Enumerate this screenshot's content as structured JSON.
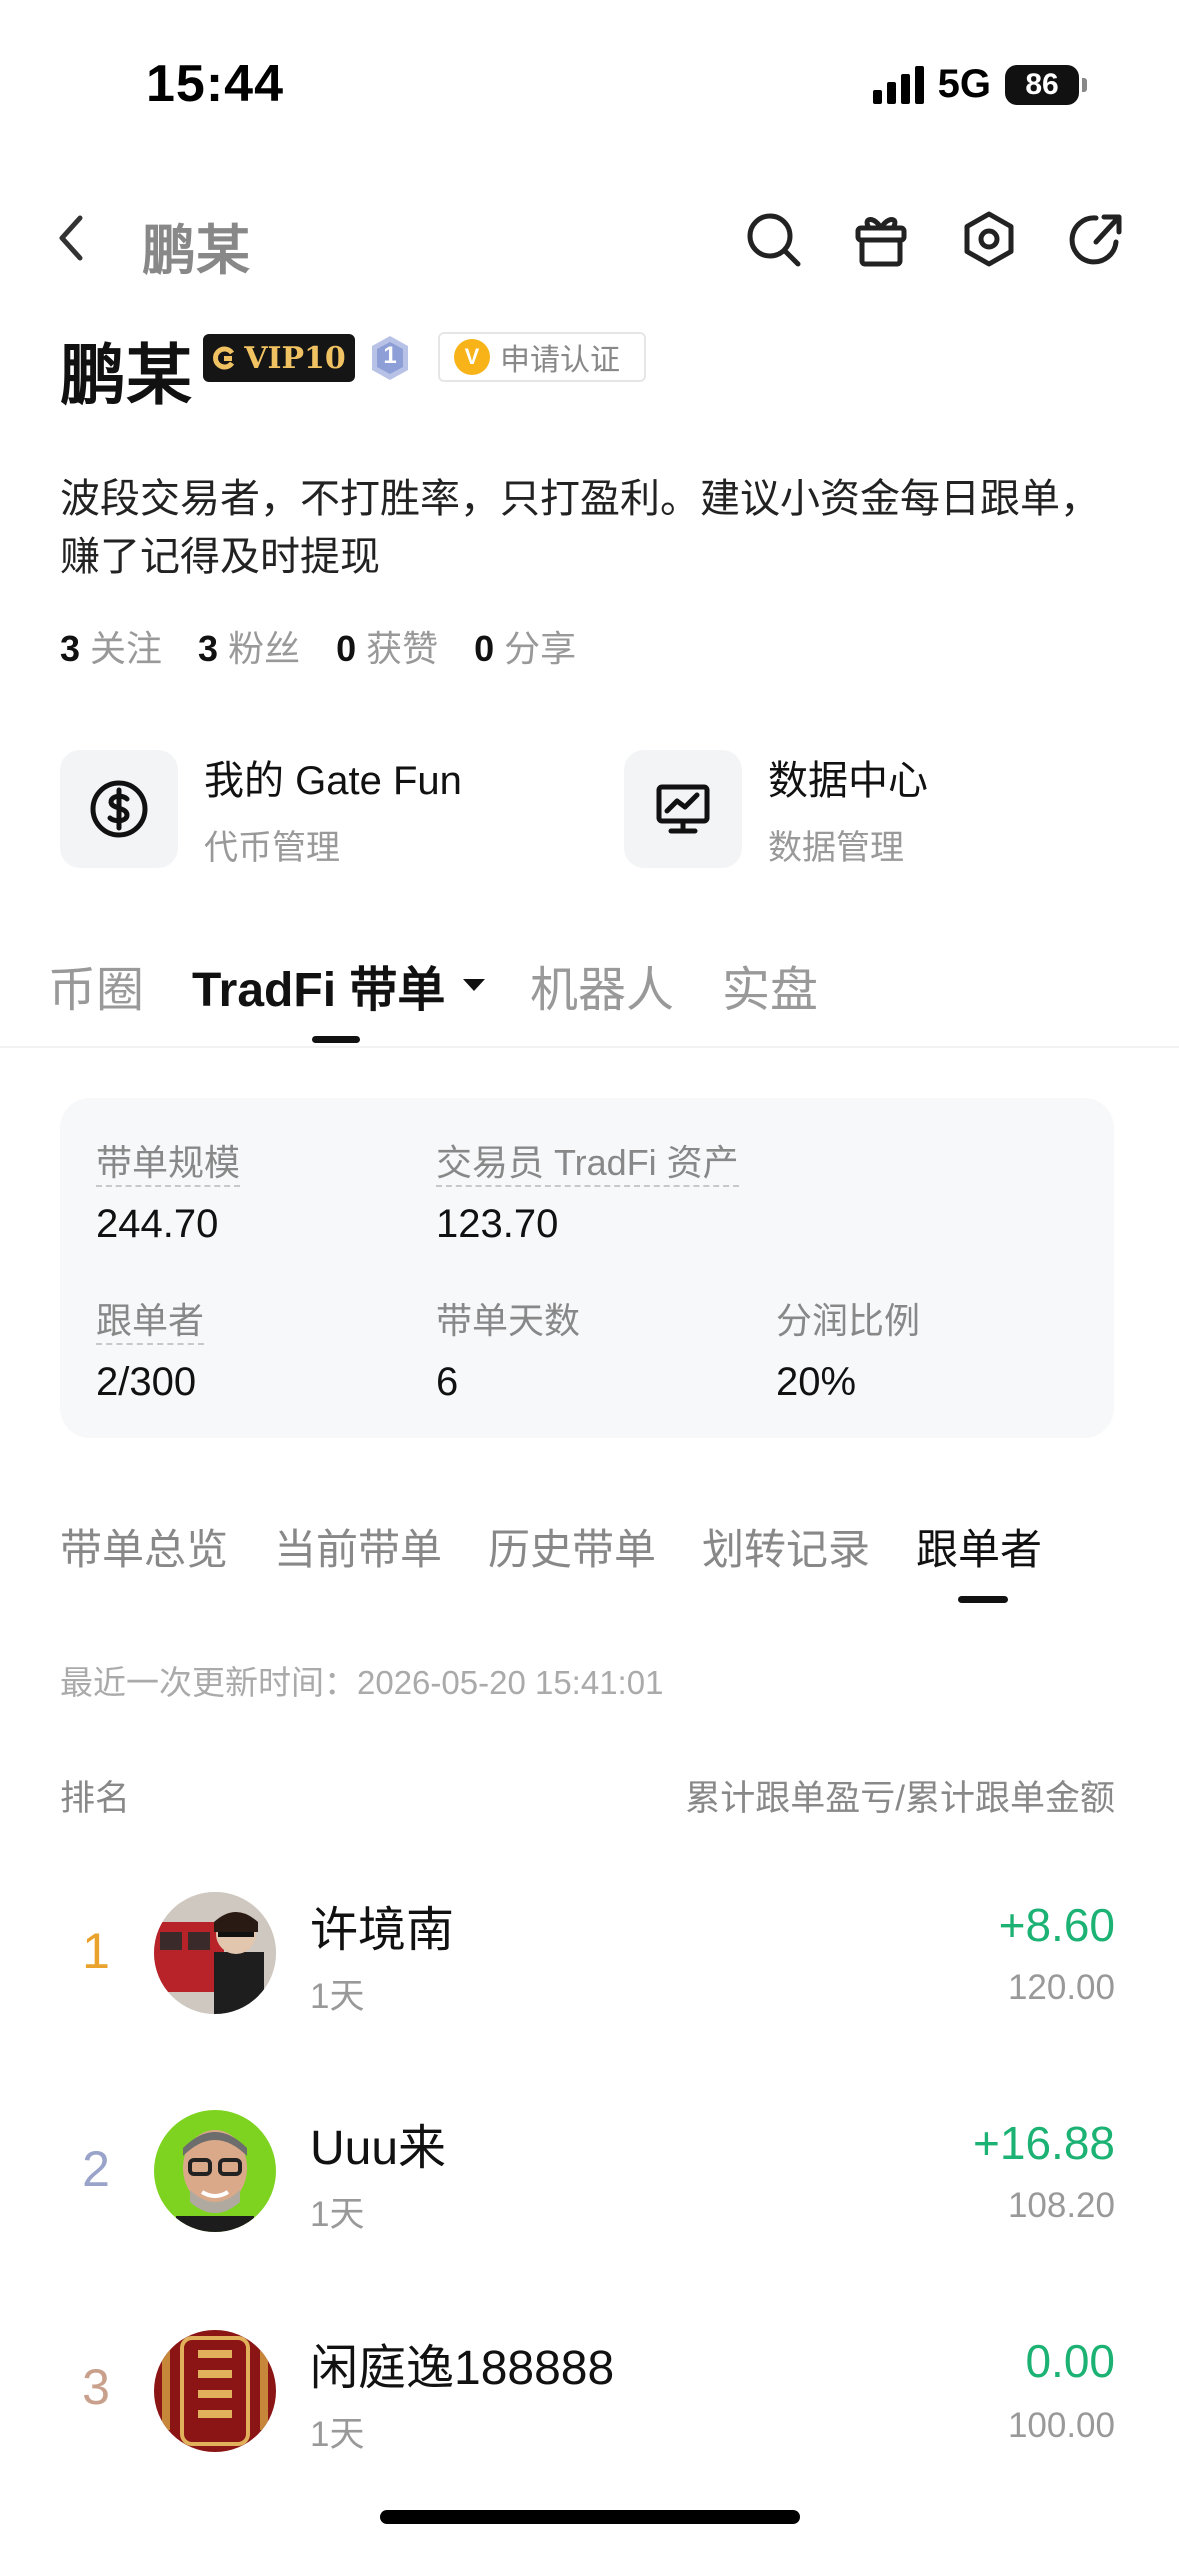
{
  "status_bar": {
    "time": "15:44",
    "network": "5G",
    "battery": "86"
  },
  "nav": {
    "title": "鹏某",
    "icons": [
      "back-icon",
      "search-icon",
      "gift-icon",
      "settings-icon",
      "share-icon"
    ]
  },
  "profile": {
    "name": "鹏某",
    "vip_label": "VIP10",
    "level_badge": "1",
    "verify_label": "申请认证",
    "bio": "波段交易者，不打胜率，只打盈利。建议小资金每日跟单，赚了记得及时提现",
    "stats": [
      {
        "value": "3",
        "label": "关注"
      },
      {
        "value": "3",
        "label": "粉丝"
      },
      {
        "value": "0",
        "label": "获赞"
      },
      {
        "value": "0",
        "label": "分享"
      }
    ]
  },
  "quick_cards": [
    {
      "title": "我的 Gate Fun",
      "subtitle": "代币管理",
      "icon": "dollar-icon"
    },
    {
      "title": "数据中心",
      "subtitle": "数据管理",
      "icon": "monitor-chart-icon"
    }
  ],
  "main_tabs": [
    {
      "label": "币圈",
      "active": false
    },
    {
      "label": "TradFi 带单",
      "active": true
    },
    {
      "label": "机器人",
      "active": false
    },
    {
      "label": "实盘",
      "active": false
    }
  ],
  "summary": {
    "scale_label": "带单规模",
    "scale_value": "244.70",
    "assets_label": "交易员 TradFi 资产",
    "assets_value": "123.70",
    "followers_label": "跟单者",
    "followers_value": "2/300",
    "days_label": "带单天数",
    "days_value": "6",
    "share_label": "分润比例",
    "share_value": "20%"
  },
  "sub_tabs": [
    {
      "label": "带单总览",
      "active": false
    },
    {
      "label": "当前带单",
      "active": false
    },
    {
      "label": "历史带单",
      "active": false
    },
    {
      "label": "划转记录",
      "active": false
    },
    {
      "label": "跟单者",
      "active": true
    }
  ],
  "update_time": "最近一次更新时间：2026-05-20 15:41:01",
  "table_header": {
    "left": "排名",
    "right": "累计跟单盈亏/累计跟单金额"
  },
  "followers": [
    {
      "rank": "1",
      "name": "许境南",
      "days": "1天",
      "pnl": "+8.60",
      "amount": "120.00",
      "rank_color": "#e9a22c"
    },
    {
      "rank": "2",
      "name": "Uuu来",
      "days": "1天",
      "pnl": "+16.88",
      "amount": "108.20",
      "rank_color": "#9aa3c9"
    },
    {
      "rank": "3",
      "name": "闲庭逸188888",
      "days": "1天",
      "pnl": "0.00",
      "amount": "100.00",
      "rank_color": "#c9a08c"
    }
  ],
  "colors": {
    "profit_green": "#1bb273",
    "vip_gold": "#f0c262"
  }
}
